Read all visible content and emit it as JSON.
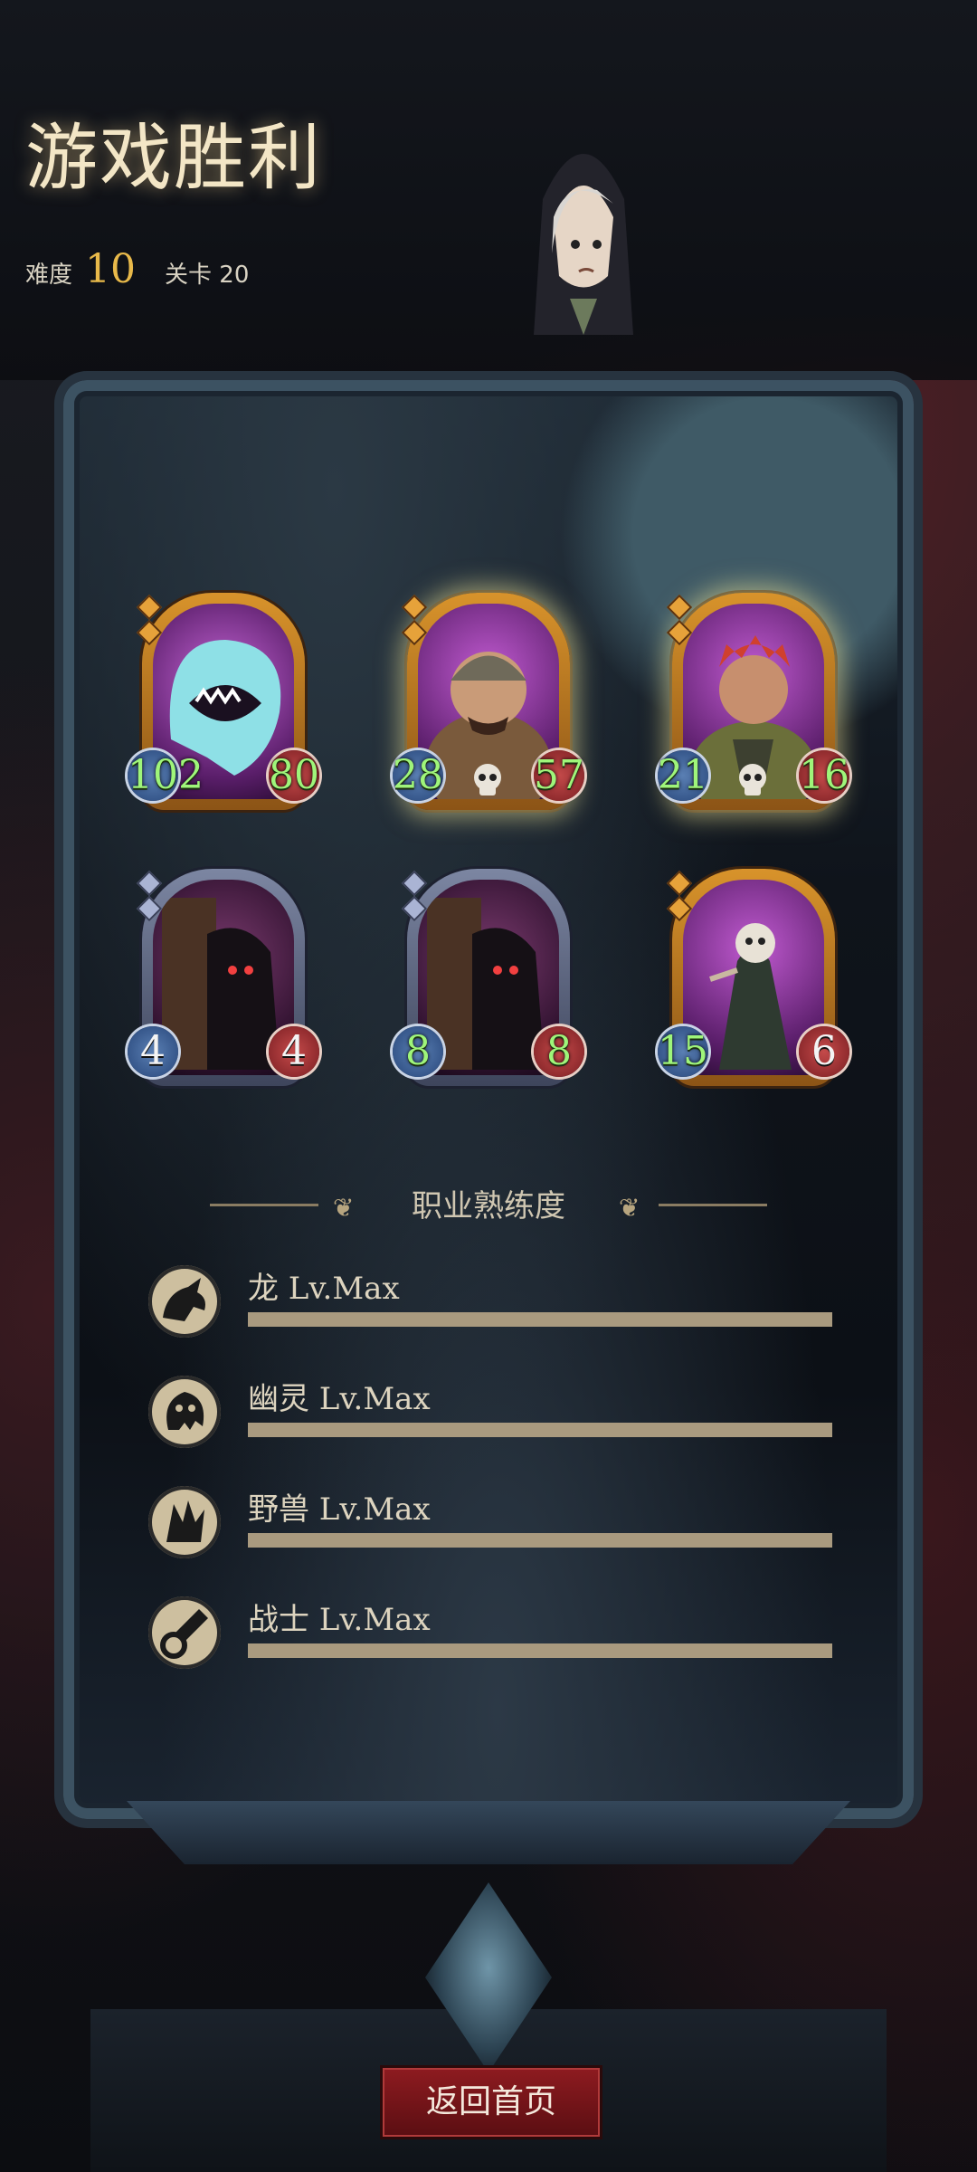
{
  "header": {
    "title": "游戏胜利",
    "difficulty_label": "难度",
    "difficulty_value": "10",
    "stage_label": "关卡 20"
  },
  "cards": [
    {
      "atk": "102",
      "hp": "80",
      "frame": "gold",
      "skull": false
    },
    {
      "atk": "28",
      "hp": "57",
      "frame": "gold",
      "skull": true
    },
    {
      "atk": "21",
      "hp": "16",
      "frame": "gold",
      "skull": true
    },
    {
      "atk": "4",
      "hp": "4",
      "frame": "silver",
      "skull": false
    },
    {
      "atk": "8",
      "hp": "8",
      "frame": "silver",
      "skull": false
    },
    {
      "atk": "15",
      "hp": "6",
      "frame": "gold",
      "skull": false
    }
  ],
  "mastery": {
    "title": "职业熟练度",
    "items": [
      {
        "label": "龙 Lv.Max",
        "icon": "dragon-icon",
        "progress": 1.0
      },
      {
        "label": "幽灵 Lv.Max",
        "icon": "ghost-icon",
        "progress": 1.0
      },
      {
        "label": "野兽 Lv.Max",
        "icon": "beast-icon",
        "progress": 1.0
      },
      {
        "label": "战士 Lv.Max",
        "icon": "warrior-icon",
        "progress": 1.0
      }
    ]
  },
  "footer": {
    "home_label": "返回首页"
  },
  "colors": {
    "accent_gold": "#e8b94a",
    "button_red": "#8e1b20",
    "stat_green": "#9ff57a"
  }
}
